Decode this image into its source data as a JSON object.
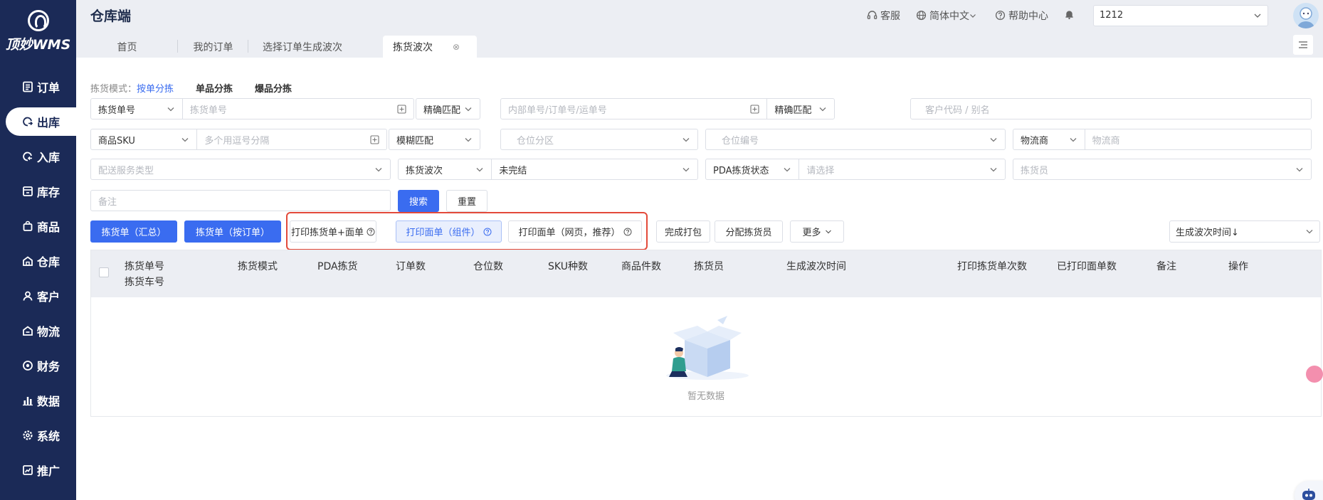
{
  "brand": {
    "logo_text": "顶妙WMS",
    "app_title": "仓库端"
  },
  "sidebar": {
    "items": [
      {
        "label": "订单",
        "icon": "order-list-icon",
        "active": false
      },
      {
        "label": "出库",
        "icon": "outbound-icon",
        "active": true
      },
      {
        "label": "入库",
        "icon": "inbound-icon",
        "active": false
      },
      {
        "label": "库存",
        "icon": "inventory-icon",
        "active": false
      },
      {
        "label": "商品",
        "icon": "bag-icon",
        "active": false
      },
      {
        "label": "仓库",
        "icon": "warehouse-icon",
        "active": false
      },
      {
        "label": "客户",
        "icon": "user-icon",
        "active": false
      },
      {
        "label": "物流",
        "icon": "logistics-icon",
        "active": false
      },
      {
        "label": "财务",
        "icon": "finance-icon",
        "active": false
      },
      {
        "label": "数据",
        "icon": "bar-chart-icon",
        "active": false
      },
      {
        "label": "系统",
        "icon": "gear-icon",
        "active": false
      },
      {
        "label": "推广",
        "icon": "promo-icon",
        "active": false
      }
    ]
  },
  "header": {
    "service": "客服",
    "language": "简体中文",
    "help": "帮助中心",
    "store_value": "1212"
  },
  "tabs": [
    {
      "label": "首页"
    },
    {
      "label": "我的订单"
    },
    {
      "label": "选择订单生成波次"
    },
    {
      "label": "拣货波次",
      "active": true
    }
  ],
  "filters": {
    "mode_label": "拣货模式：",
    "modes": [
      "按单分拣",
      "单品分拣",
      "爆品分拣"
    ],
    "row1": {
      "pick_no_type": "拣货单号",
      "pick_no_placeholder": "拣货单号",
      "match1": "精确匹配",
      "order_no_placeholder": "内部单号/订单号/运单号",
      "match2": "精确匹配",
      "customer_placeholder": "客户代码 / 别名"
    },
    "row2": {
      "sku_type": "商品SKU",
      "sku_placeholder": "多个用逗号分隔",
      "match3": "模糊匹配",
      "zone_placeholder": "仓位分区",
      "location_placeholder": "仓位编号",
      "carrier_label": "物流商",
      "carrier_placeholder": "物流商"
    },
    "row3": {
      "service_placeholder": "配送服务类型",
      "wave_label": "拣货波次",
      "wave_value": "未完结",
      "pda_label": "PDA拣货状态",
      "pda_placeholder": "请选择",
      "picker_placeholder": "拣货员"
    },
    "row4": {
      "remark_placeholder": "备注",
      "search": "搜索",
      "reset": "重置"
    }
  },
  "actions": {
    "pick_summary": "拣货单（汇总）",
    "pick_by_order": "拣货单（按订单）",
    "print_pick_label": "打印拣货单+面单",
    "print_label_component": "打印面单（组件）",
    "print_label_web": "打印面单（网页，推荐）",
    "finish_pack": "完成打包",
    "assign_picker": "分配拣货员",
    "more": "更多",
    "sort": "生成波次时间↓"
  },
  "table": {
    "columns": [
      "拣货单号",
      "拣货车号",
      "拣货模式",
      "PDA拣货",
      "订单数",
      "仓位数",
      "SKU种数",
      "商品件数",
      "拣货员",
      "生成波次时间",
      "打印拣货单次数",
      "已打印面单数",
      "备注",
      "操作"
    ],
    "empty_text": "暂无数据"
  },
  "colors": {
    "sidebar": "#1b2a57",
    "primary": "#3a6cf0",
    "highlight": "#e34a3a"
  }
}
